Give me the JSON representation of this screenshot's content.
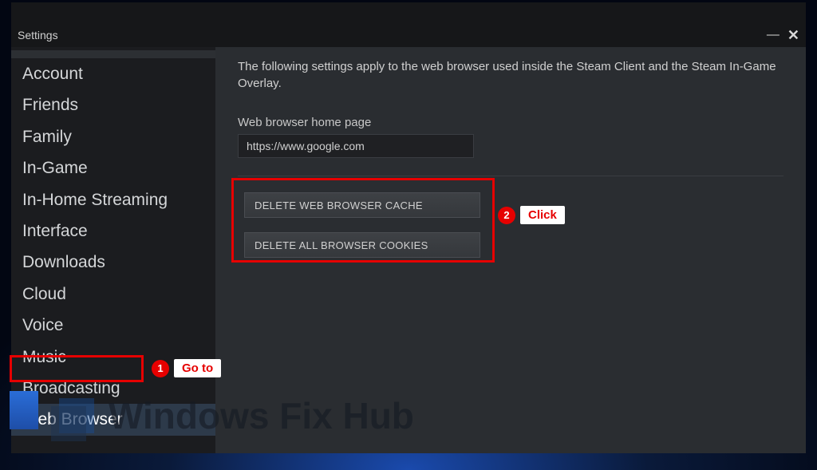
{
  "window": {
    "top_strip_text": "",
    "title": "Settings"
  },
  "sidebar": {
    "items": [
      {
        "label": "Account",
        "selected": false
      },
      {
        "label": "Friends",
        "selected": false
      },
      {
        "label": "Family",
        "selected": false
      },
      {
        "label": "In-Game",
        "selected": false
      },
      {
        "label": "In-Home Streaming",
        "selected": false
      },
      {
        "label": "Interface",
        "selected": false
      },
      {
        "label": "Downloads",
        "selected": false
      },
      {
        "label": "Cloud",
        "selected": false
      },
      {
        "label": "Voice",
        "selected": false
      },
      {
        "label": "Music",
        "selected": false
      },
      {
        "label": "Broadcasting",
        "selected": false
      },
      {
        "label": "Web Browser",
        "selected": true
      }
    ]
  },
  "content": {
    "description": "The following settings apply to the web browser used inside the Steam Client and the Steam In-Game Overlay.",
    "home_page_label": "Web browser home page",
    "home_page_value": "https://www.google.com",
    "delete_cache_label": "DELETE WEB BROWSER CACHE",
    "delete_cookies_label": "DELETE ALL BROWSER COOKIES"
  },
  "annotations": {
    "step1_num": "1",
    "step1_label": "Go to",
    "step2_num": "2",
    "step2_label": "Click"
  },
  "watermark": {
    "text": "Windows Fix Hub"
  }
}
